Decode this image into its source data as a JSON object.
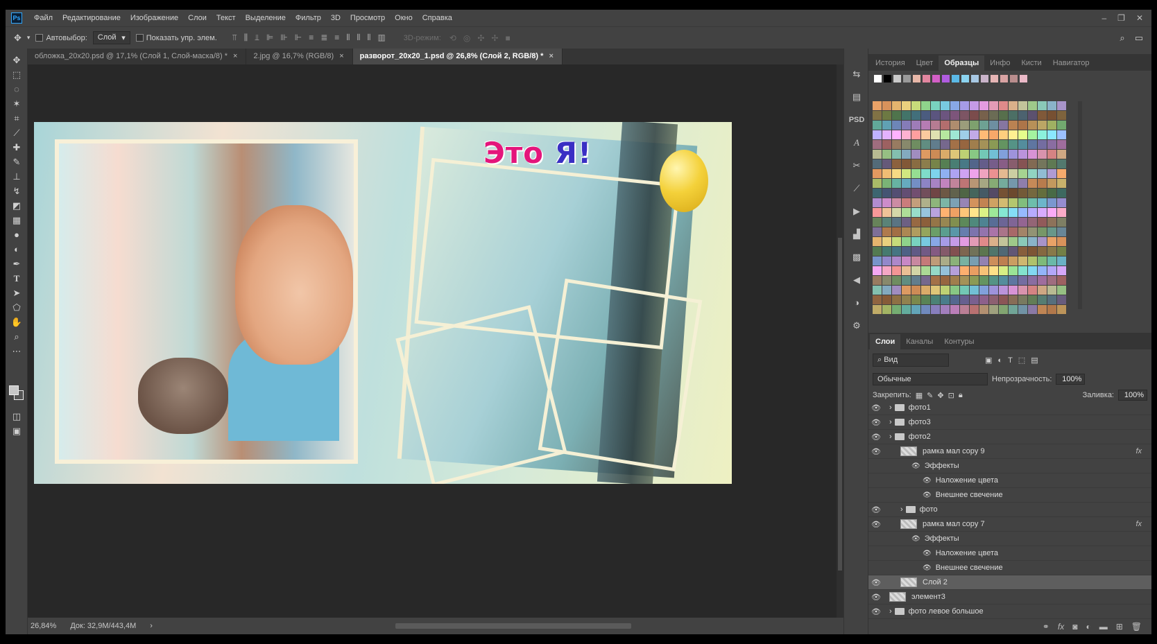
{
  "menu": [
    "Файл",
    "Редактирование",
    "Изображение",
    "Слои",
    "Текст",
    "Выделение",
    "Фильтр",
    "3D",
    "Просмотр",
    "Окно",
    "Справка"
  ],
  "window_controls": [
    "–",
    "❐",
    "✕"
  ],
  "options": {
    "autoselect_label": "Автовыбор:",
    "autoselect_value": "Слой",
    "show_transform_label": "Показать упр. элем.",
    "mode3d_label": "3D-режим:"
  },
  "tabs": [
    {
      "label": "обложка_20x20.psd @ 17,1% (Слой 1, Слой-маска/8) *"
    },
    {
      "label": "2.jpg @ 16,7% (RGB/8)"
    },
    {
      "label": "разворот_20x20_1.psd @ 26,8% (Слой 2, RGB/8) *"
    }
  ],
  "canvas": {
    "title_word1": "Это",
    "title_word2": "Я!"
  },
  "status": {
    "zoom": "26,84%",
    "doc": "Док: 32,9M/443,4M"
  },
  "top_panel_tabs": [
    "История",
    "Цвет",
    "Образцы",
    "Инфо",
    "Кисти",
    "Навигатор"
  ],
  "recent_swatches": [
    "#ffffff",
    "#000000",
    "#c9c9c9",
    "#9a9a9a",
    "#e8b7a8",
    "#e2869f",
    "#d35fc6",
    "#b05ce0",
    "#5bb9e6",
    "#8bd3ef",
    "#a7c8e3",
    "#c9b3c9",
    "#e6b5b5",
    "#d9a3a3",
    "#b98d8d",
    "#eab9c7"
  ],
  "swatch_palette": [
    "#e9a267",
    "#d8925b",
    "#e5b46e",
    "#ead07e",
    "#c7dc7a",
    "#8fd38b",
    "#79d2bf",
    "#78c9e0",
    "#88a8e6",
    "#a69be6",
    "#c59be6",
    "#e39be0",
    "#e39bb6",
    "#e08a8a",
    "#d9b08a",
    "#c2c49a",
    "#9ec98a",
    "#8ac9b8",
    "#8ab3c9",
    "#a894c9"
  ],
  "layer_panel": {
    "tabs": [
      "Слои",
      "Каналы",
      "Контуры"
    ],
    "filter": "Вид",
    "blend_mode": "Обычные",
    "opacity_label": "Непрозрачность:",
    "opacity_value": "100%",
    "lock_label": "Закрепить:",
    "fill_label": "Заливка:",
    "fill_value": "100%",
    "rows": [
      {
        "name": "фото1",
        "kind": "folder",
        "indent": 0
      },
      {
        "name": "фото3",
        "kind": "folder",
        "indent": 0
      },
      {
        "name": "фото2",
        "kind": "folder",
        "indent": 0
      },
      {
        "name": "рамка мал copy 9",
        "kind": "layer",
        "indent": 1,
        "fx": "fx"
      },
      {
        "name": "Эффекты",
        "kind": "effect",
        "indent": 2
      },
      {
        "name": "Наложение цвета",
        "kind": "effect",
        "indent": 3
      },
      {
        "name": "Внешнее свечение",
        "kind": "effect",
        "indent": 3
      },
      {
        "name": "фото",
        "kind": "folder",
        "indent": 1
      },
      {
        "name": "рамка мал copy 7",
        "kind": "layer",
        "indent": 1,
        "fx": "fx"
      },
      {
        "name": "Эффекты",
        "kind": "effect",
        "indent": 2
      },
      {
        "name": "Наложение цвета",
        "kind": "effect",
        "indent": 3
      },
      {
        "name": "Внешнее свечение",
        "kind": "effect",
        "indent": 3
      },
      {
        "name": "Слой 2",
        "kind": "layer",
        "indent": 1,
        "selected": true
      },
      {
        "name": "элемент3",
        "kind": "layer",
        "indent": 0
      },
      {
        "name": "фото левое большое",
        "kind": "folder",
        "indent": 0
      }
    ]
  }
}
